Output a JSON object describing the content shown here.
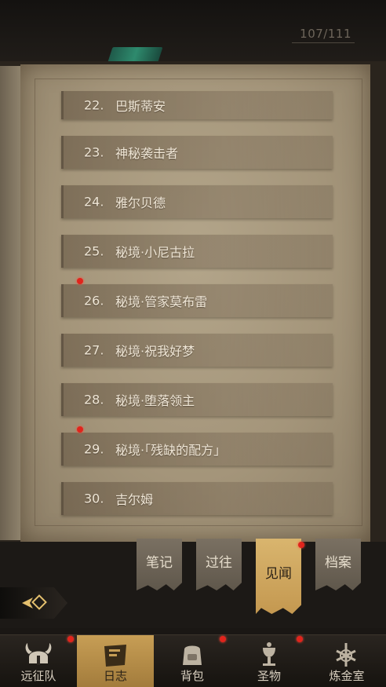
{
  "counter": "107/111",
  "entries": [
    {
      "num": "22.",
      "title": "巴斯蒂安",
      "dot": false
    },
    {
      "num": "23.",
      "title": "神秘袭击者",
      "dot": false
    },
    {
      "num": "24.",
      "title": "雅尔贝德",
      "dot": false
    },
    {
      "num": "25.",
      "title": "秘境·小尼古拉",
      "dot": false
    },
    {
      "num": "26.",
      "title": "秘境·管家莫布雷",
      "dot": true
    },
    {
      "num": "27.",
      "title": "秘境·祝我好梦",
      "dot": false
    },
    {
      "num": "28.",
      "title": "秘境·堕落领主",
      "dot": false
    },
    {
      "num": "29.",
      "title": "秘境·「残缺的配方」",
      "dot": true
    },
    {
      "num": "30.",
      "title": "吉尔姆",
      "dot": false
    }
  ],
  "tabs": [
    {
      "label": "笔记",
      "active": false
    },
    {
      "label": "过往",
      "active": false
    },
    {
      "label": "见闻",
      "active": true
    },
    {
      "label": "档案",
      "active": false
    }
  ],
  "nav": [
    {
      "label": "远征队",
      "icon": "viking-helmet-icon",
      "active": false
    },
    {
      "label": "日志",
      "icon": "journal-book-icon",
      "active": true
    },
    {
      "label": "背包",
      "icon": "backpack-icon",
      "active": false
    },
    {
      "label": "圣物",
      "icon": "relic-chalice-icon",
      "active": false
    },
    {
      "label": "炼金室",
      "icon": "alchemy-symbol-icon",
      "active": false
    }
  ],
  "colors": {
    "notification": "#e0241c",
    "active_tab": "#d9b56e",
    "page": "#a4957a"
  }
}
